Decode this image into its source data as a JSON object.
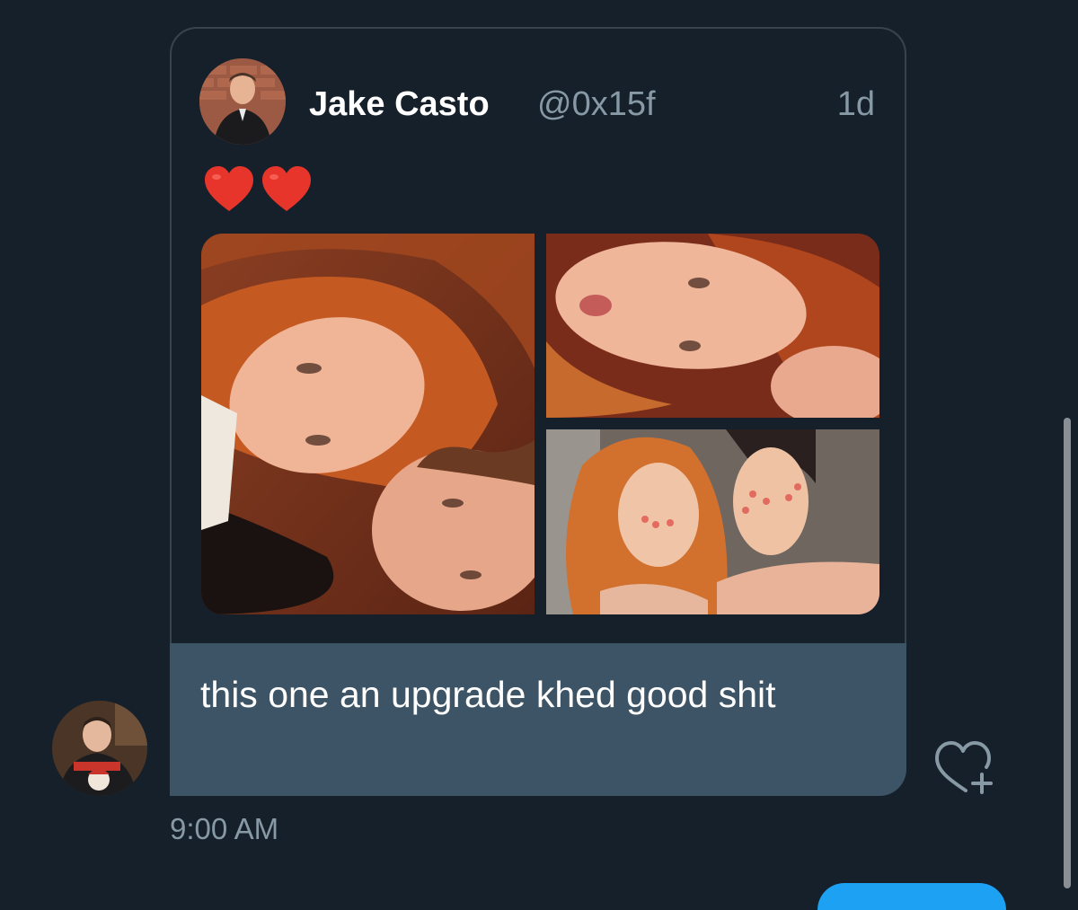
{
  "quoted_tweet": {
    "author_name": "Jake Casto",
    "author_handle": "@0x15f",
    "timestamp": "1d",
    "text_emoji": [
      "red-heart",
      "red-heart"
    ],
    "media_count": 3
  },
  "message": {
    "text": "this one an upgrade khed good shit",
    "time": "9:00 AM"
  },
  "colors": {
    "background": "#15202b",
    "bubble": "#3d5466",
    "border": "#38444d",
    "muted_text": "#8899a6",
    "heart": "#e8352b",
    "accent": "#1da1f2"
  },
  "icons": {
    "like_button": "heart-plus-icon"
  }
}
